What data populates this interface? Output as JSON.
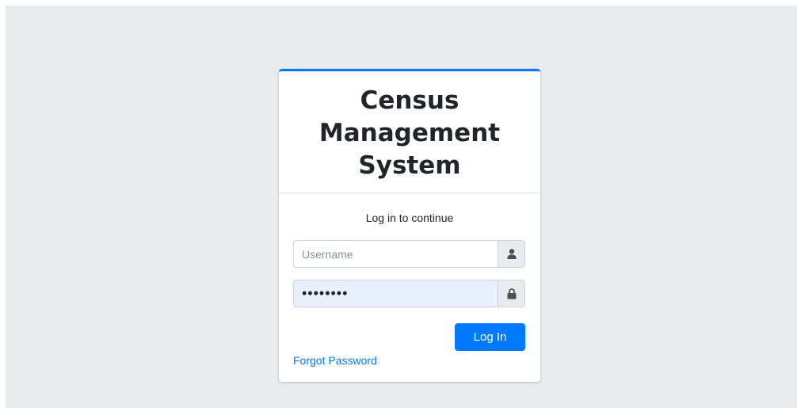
{
  "app": {
    "title": "Census Management System"
  },
  "login": {
    "prompt": "Log in to continue",
    "username": {
      "value": "",
      "placeholder": "Username",
      "icon": "user-icon"
    },
    "password": {
      "value": "••••••••",
      "placeholder": "",
      "icon": "lock-icon"
    },
    "submit_label": "Log In",
    "forgot_label": "Forgot Password"
  },
  "colors": {
    "accent": "#007bff",
    "background": "#e9ecef",
    "autofill": "#e8f0fe"
  }
}
